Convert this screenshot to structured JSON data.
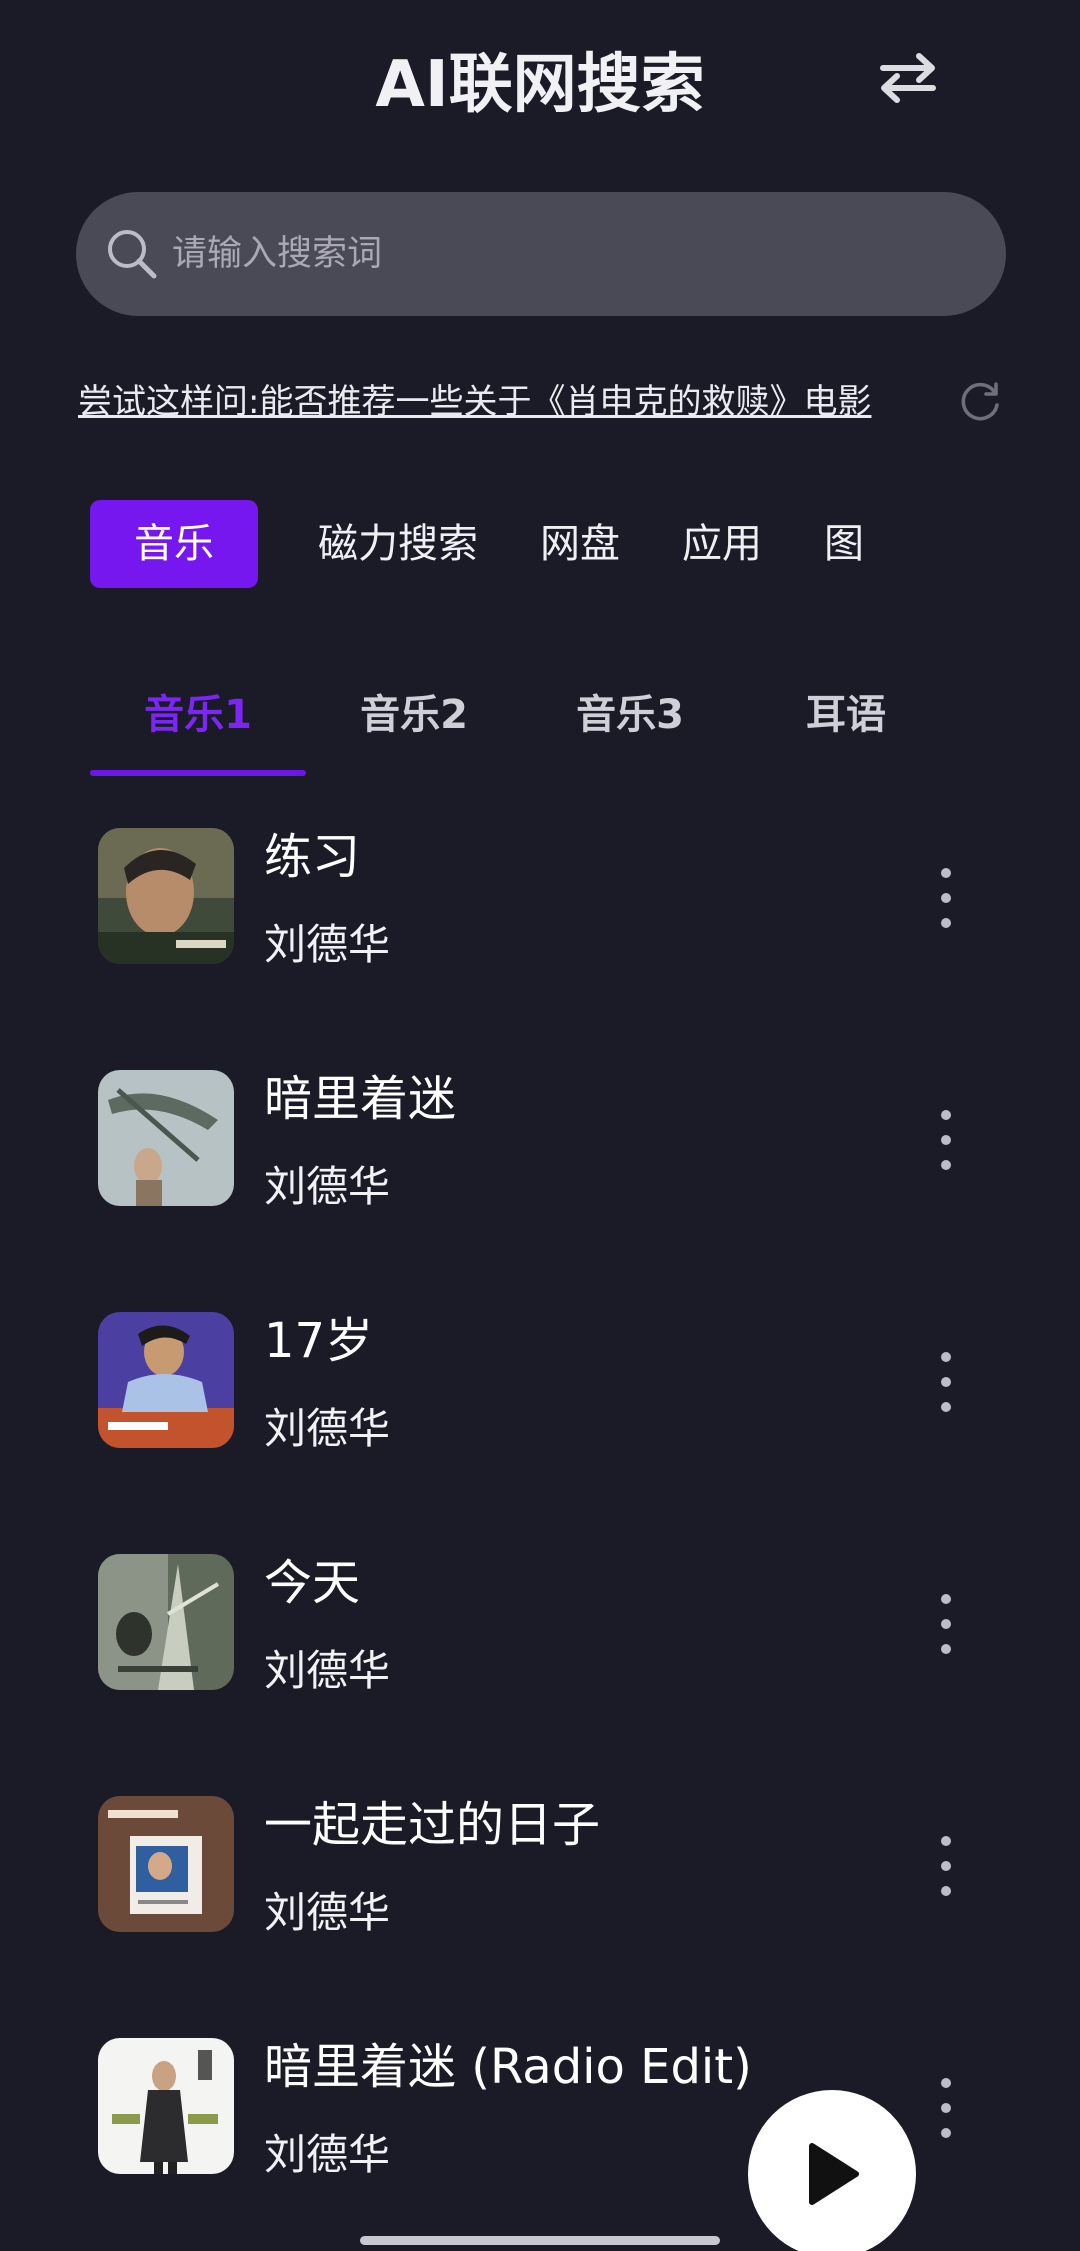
{
  "header": {
    "title": "AI联网搜索",
    "switch_icon": "swap-arrows-icon"
  },
  "search": {
    "placeholder": "请输入搜索词",
    "value": ""
  },
  "suggestion": {
    "text": "尝试这样问:能否推荐一些关于《肖申克的救赎》电影",
    "refresh_icon": "refresh-icon"
  },
  "categories": [
    {
      "label": "音乐",
      "active": true
    },
    {
      "label": "磁力搜索",
      "active": false
    },
    {
      "label": "网盘",
      "active": false
    },
    {
      "label": "应用",
      "active": false
    },
    {
      "label": "图",
      "active": false
    }
  ],
  "subtabs": [
    {
      "label": "音乐1",
      "active": true
    },
    {
      "label": "音乐2",
      "active": false
    },
    {
      "label": "音乐3",
      "active": false
    },
    {
      "label": "耳语",
      "active": false
    }
  ],
  "songs": [
    {
      "title": "练习",
      "artist": "刘德华"
    },
    {
      "title": "暗里着迷",
      "artist": "刘德华"
    },
    {
      "title": "17岁",
      "artist": "刘德华"
    },
    {
      "title": "今天",
      "artist": "刘德华"
    },
    {
      "title": "一起走过的日子",
      "artist": "刘德华"
    },
    {
      "title": "暗里着迷 (Radio Edit)",
      "artist": "刘德华"
    }
  ],
  "colors": {
    "background": "#1b1a27",
    "accent": "#7617f0",
    "search_bg": "#4a4956"
  }
}
